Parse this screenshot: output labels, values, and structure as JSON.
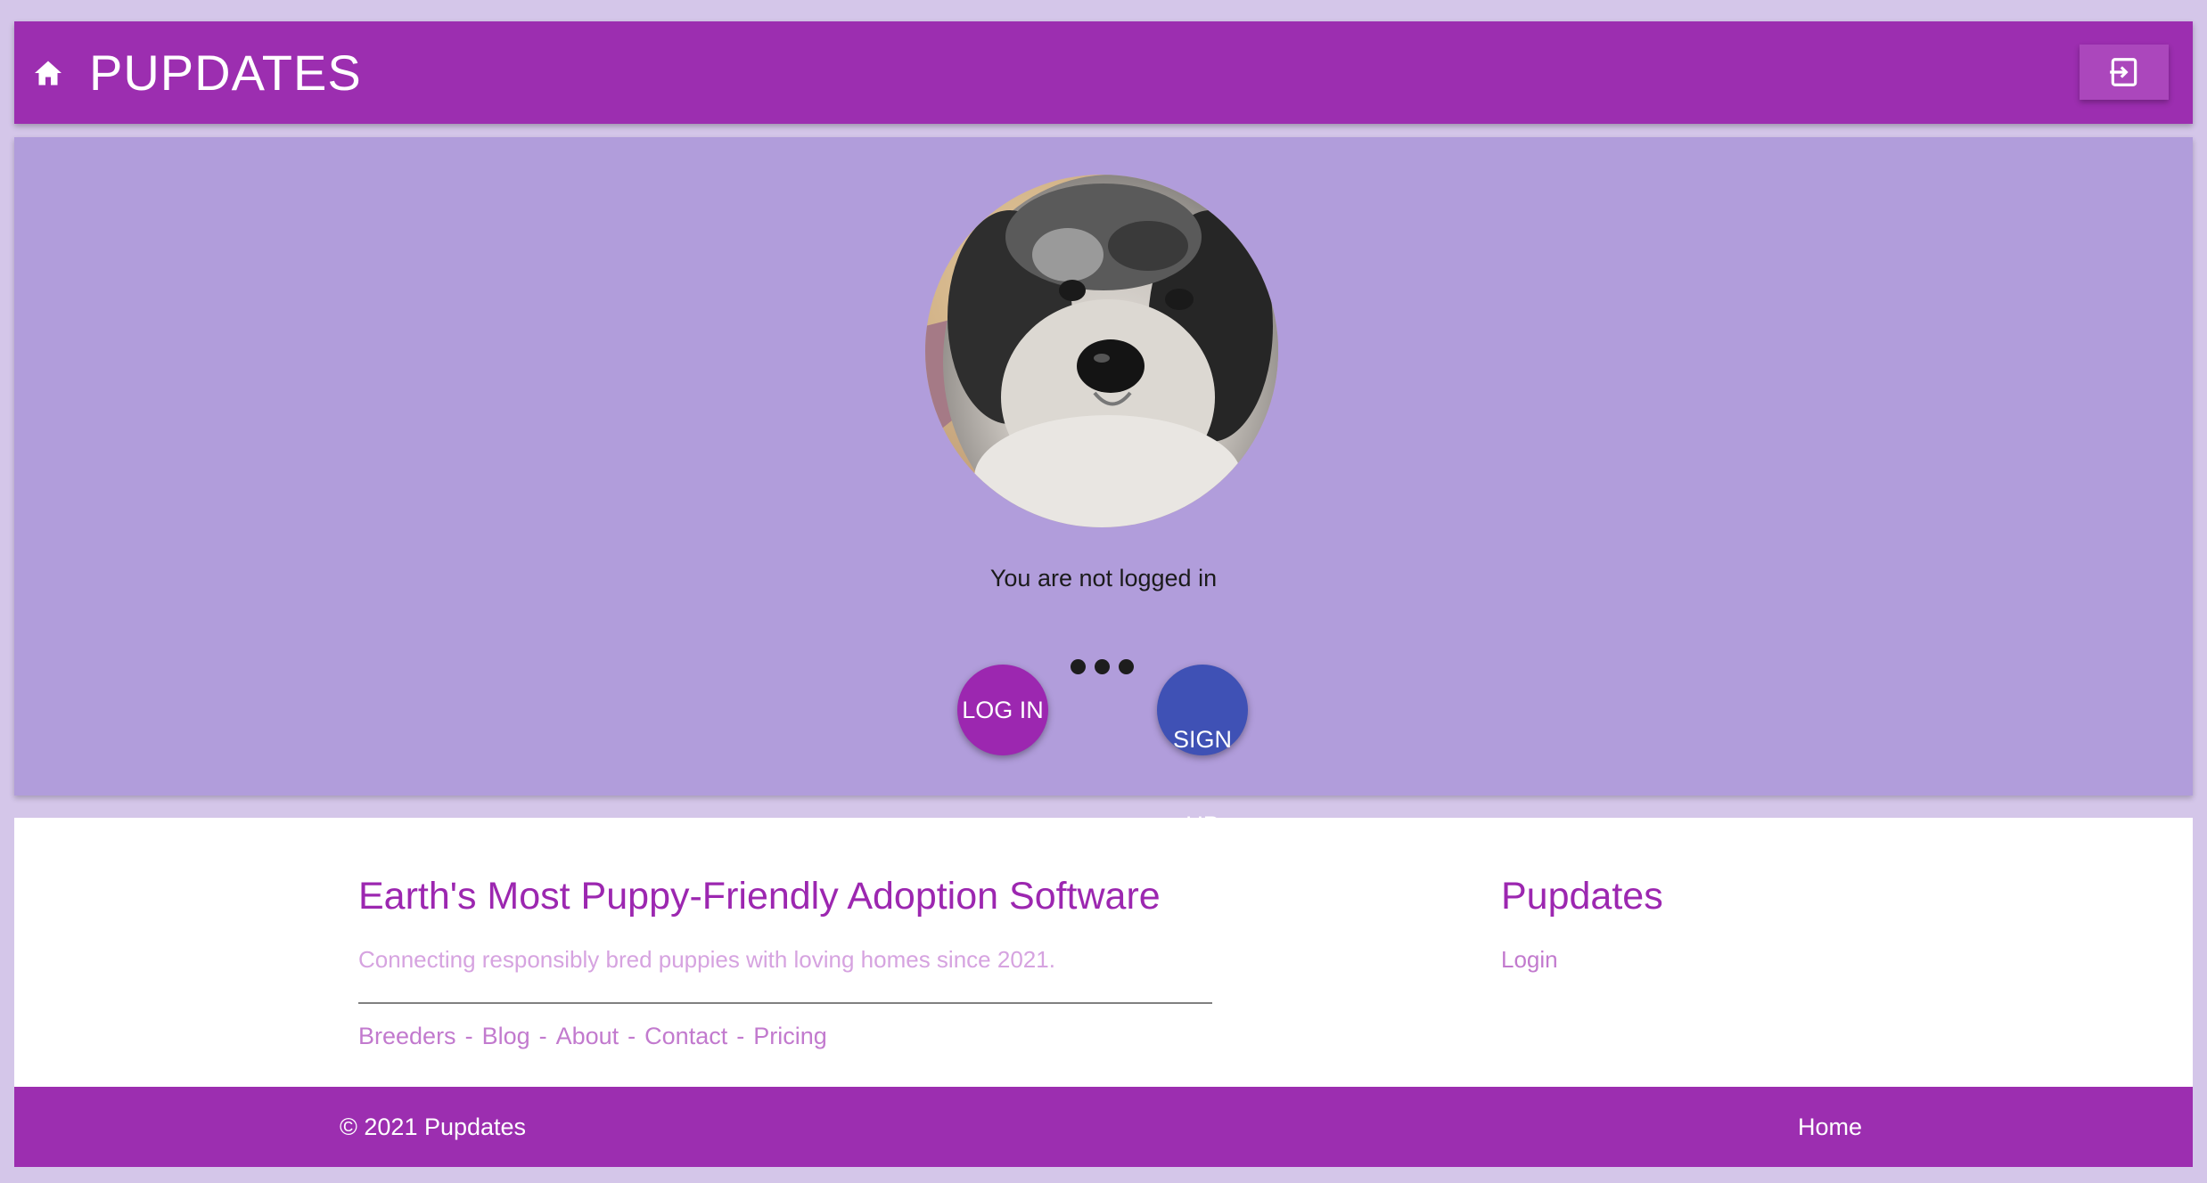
{
  "appbar": {
    "title": "PUPDATES",
    "home_icon": "home-icon",
    "logout_icon": "logout-icon",
    "color": "#9c2eb0"
  },
  "hero": {
    "avatar_alt": "dog-photo",
    "status_text": "You are not logged in",
    "login_label": "LOG IN",
    "signup_label": "SIGN UP",
    "login_color": "#9c27b0",
    "signup_color": "#3f51b5",
    "background": "#b19ddb"
  },
  "footer": {
    "tagline_title": "Earth's Most Puppy-Friendly Adoption Software",
    "tagline_sub": "Connecting responsibly bred puppies with loving homes since 2021.",
    "links": [
      "Breeders",
      "Blog",
      "About",
      "Contact",
      "Pricing"
    ],
    "separator": "-",
    "column_title": "Pupdates",
    "column_link": "Login",
    "copyright": "© 2021 Pupdates",
    "bottom_link": "Home"
  }
}
